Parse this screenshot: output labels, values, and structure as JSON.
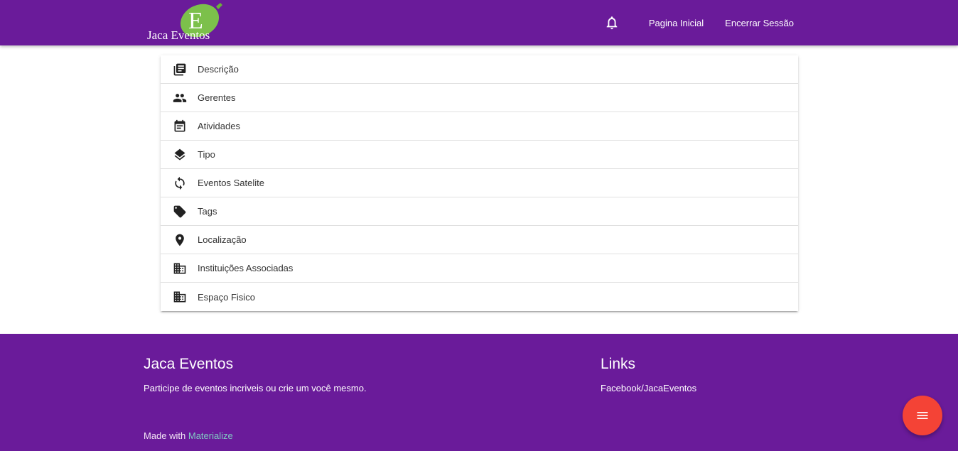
{
  "navbar": {
    "logo_text": "Jaca Eventos",
    "logo_letter": "E",
    "bell_icon": "notifications-icon",
    "links": [
      "Pagina Inicial",
      "Encerrar Sessão"
    ]
  },
  "menu": {
    "items": [
      {
        "label": "Descrição",
        "icon": "library-books-icon"
      },
      {
        "label": "Gerentes",
        "icon": "people-icon"
      },
      {
        "label": "Atividades",
        "icon": "event-note-icon"
      },
      {
        "label": "Tipo",
        "icon": "layers-icon"
      },
      {
        "label": "Eventos Satelite",
        "icon": "sync-icon"
      },
      {
        "label": "Tags",
        "icon": "label-icon"
      },
      {
        "label": "Localização",
        "icon": "place-icon"
      },
      {
        "label": "Instituições Associadas",
        "icon": "business-icon"
      },
      {
        "label": "Espaço Fisico",
        "icon": "business-icon"
      }
    ]
  },
  "footer": {
    "brand_title": "Jaca Eventos",
    "brand_text": "Participe de eventos incriveis ou crie um você mesmo.",
    "links_title": "Links",
    "links_item": "Facebook/JacaEventos",
    "made_with": "Made with ",
    "made_with_link": "Materialize"
  },
  "fab": {
    "icon": "menu-icon"
  },
  "colors": {
    "primary": "#6a1b9a",
    "fab": "#f44336",
    "logo_green": "#7cc04b",
    "link_teal": "#80cbc4"
  }
}
